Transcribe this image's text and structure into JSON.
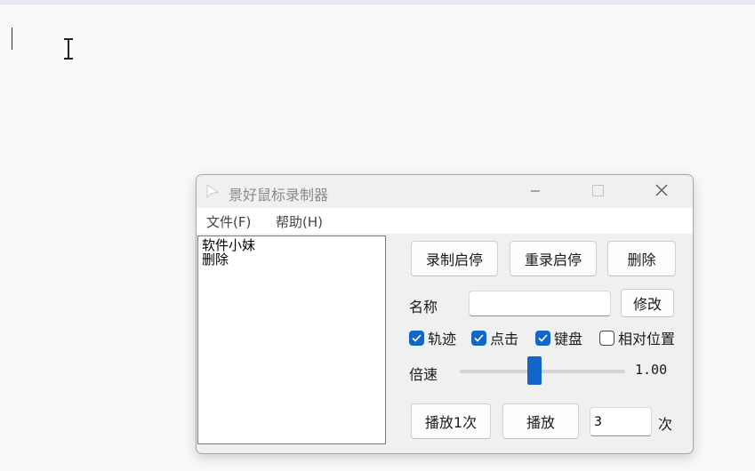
{
  "app": {
    "title": "景好鼠标录制器",
    "menu": [
      "文件(F)",
      "帮助(H)"
    ]
  },
  "list": {
    "items": [
      "软件小妹",
      "删除"
    ]
  },
  "buttons": {
    "record": "录制启停",
    "rerecord": "重录启停",
    "delete": "删除",
    "modify": "修改",
    "play_once": "播放1次",
    "play": "播放"
  },
  "name": {
    "label": "名称",
    "value": ""
  },
  "options": [
    {
      "label": "轨迹",
      "checked": true
    },
    {
      "label": "点击",
      "checked": true
    },
    {
      "label": "键盘",
      "checked": true
    },
    {
      "label": "相对位置",
      "checked": false
    }
  ],
  "speed": {
    "label": "倍速",
    "value": "1.00"
  },
  "repeat": {
    "count": "3",
    "unit": "次"
  },
  "colors": {
    "accent": "#1266c8"
  },
  "icons": {
    "app": "cursor-arrow-icon",
    "minimize": "minimize-icon",
    "maximize": "maximize-icon",
    "close": "close-icon",
    "checkmark": "checkmark-icon"
  }
}
